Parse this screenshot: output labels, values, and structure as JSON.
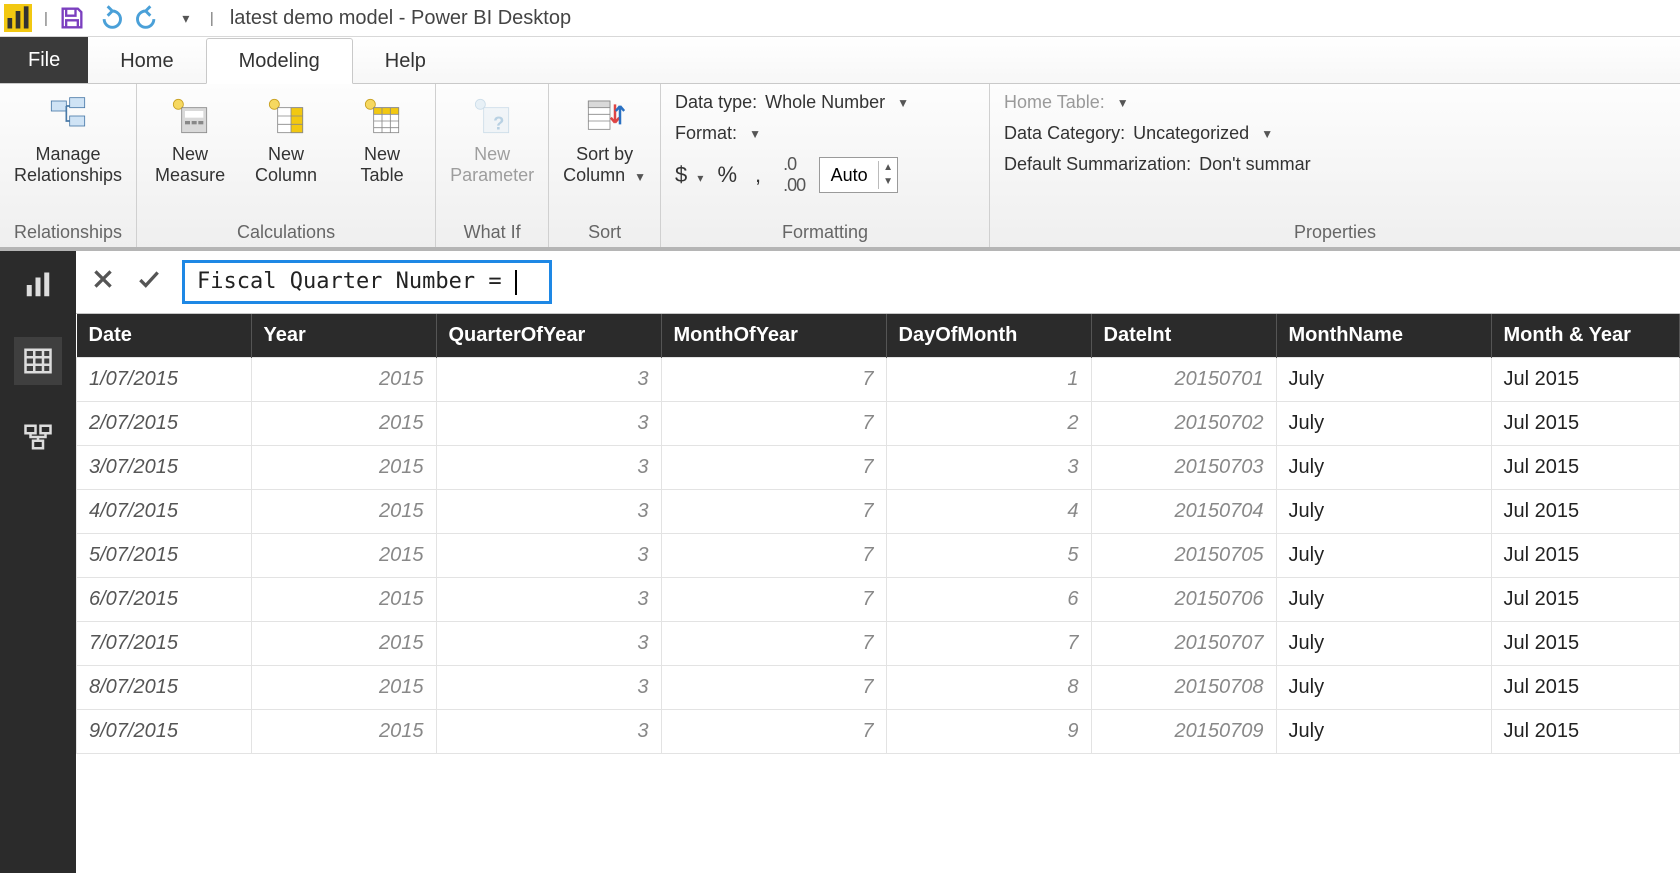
{
  "titlebar": {
    "appName": "Power BI Desktop",
    "docName": "latest demo model",
    "title": "latest demo model - Power BI Desktop"
  },
  "menu": {
    "file": "File",
    "tabs": [
      "Home",
      "Modeling",
      "Help"
    ],
    "activeIndex": 1
  },
  "ribbon": {
    "groups": {
      "relationships": {
        "label": "Relationships",
        "buttons": {
          "manage": "Manage\nRelationships"
        }
      },
      "calculations": {
        "label": "Calculations",
        "buttons": {
          "newMeasure": "New\nMeasure",
          "newColumn": "New\nColumn",
          "newTable": "New\nTable"
        }
      },
      "whatif": {
        "label": "What If",
        "buttons": {
          "newParameter": "New\nParameter"
        }
      },
      "sort": {
        "label": "Sort",
        "buttons": {
          "sortBy": "Sort by\nColumn"
        }
      },
      "formatting": {
        "label": "Formatting",
        "dataTypeLabel": "Data type:",
        "dataTypeValue": "Whole Number",
        "formatLabel": "Format:",
        "decimalsValue": "Auto"
      },
      "properties": {
        "label": "Properties",
        "homeTable": "Home Table:",
        "dataCategoryLabel": "Data Category:",
        "dataCategoryValue": "Uncategorized",
        "summarizationLabel": "Default Summarization:",
        "summarizationValue": "Don't summar"
      }
    }
  },
  "formulaBar": {
    "expression": "Fiscal Quarter Number ="
  },
  "table": {
    "columns": [
      "Date",
      "Year",
      "QuarterOfYear",
      "MonthOfYear",
      "DayOfMonth",
      "DateInt",
      "MonthName",
      "Month & Year"
    ],
    "rows": [
      {
        "Date": "1/07/2015",
        "Year": "2015",
        "QuarterOfYear": "3",
        "MonthOfYear": "7",
        "DayOfMonth": "1",
        "DateInt": "20150701",
        "MonthName": "July",
        "MonthYear": "Jul 2015"
      },
      {
        "Date": "2/07/2015",
        "Year": "2015",
        "QuarterOfYear": "3",
        "MonthOfYear": "7",
        "DayOfMonth": "2",
        "DateInt": "20150702",
        "MonthName": "July",
        "MonthYear": "Jul 2015"
      },
      {
        "Date": "3/07/2015",
        "Year": "2015",
        "QuarterOfYear": "3",
        "MonthOfYear": "7",
        "DayOfMonth": "3",
        "DateInt": "20150703",
        "MonthName": "July",
        "MonthYear": "Jul 2015"
      },
      {
        "Date": "4/07/2015",
        "Year": "2015",
        "QuarterOfYear": "3",
        "MonthOfYear": "7",
        "DayOfMonth": "4",
        "DateInt": "20150704",
        "MonthName": "July",
        "MonthYear": "Jul 2015"
      },
      {
        "Date": "5/07/2015",
        "Year": "2015",
        "QuarterOfYear": "3",
        "MonthOfYear": "7",
        "DayOfMonth": "5",
        "DateInt": "20150705",
        "MonthName": "July",
        "MonthYear": "Jul 2015"
      },
      {
        "Date": "6/07/2015",
        "Year": "2015",
        "QuarterOfYear": "3",
        "MonthOfYear": "7",
        "DayOfMonth": "6",
        "DateInt": "20150706",
        "MonthName": "July",
        "MonthYear": "Jul 2015"
      },
      {
        "Date": "7/07/2015",
        "Year": "2015",
        "QuarterOfYear": "3",
        "MonthOfYear": "7",
        "DayOfMonth": "7",
        "DateInt": "20150707",
        "MonthName": "July",
        "MonthYear": "Jul 2015"
      },
      {
        "Date": "8/07/2015",
        "Year": "2015",
        "QuarterOfYear": "3",
        "MonthOfYear": "7",
        "DayOfMonth": "8",
        "DateInt": "20150708",
        "MonthName": "July",
        "MonthYear": "Jul 2015"
      },
      {
        "Date": "9/07/2015",
        "Year": "2015",
        "QuarterOfYear": "3",
        "MonthOfYear": "7",
        "DayOfMonth": "9",
        "DateInt": "20150709",
        "MonthName": "July",
        "MonthYear": "Jul 2015"
      }
    ]
  }
}
